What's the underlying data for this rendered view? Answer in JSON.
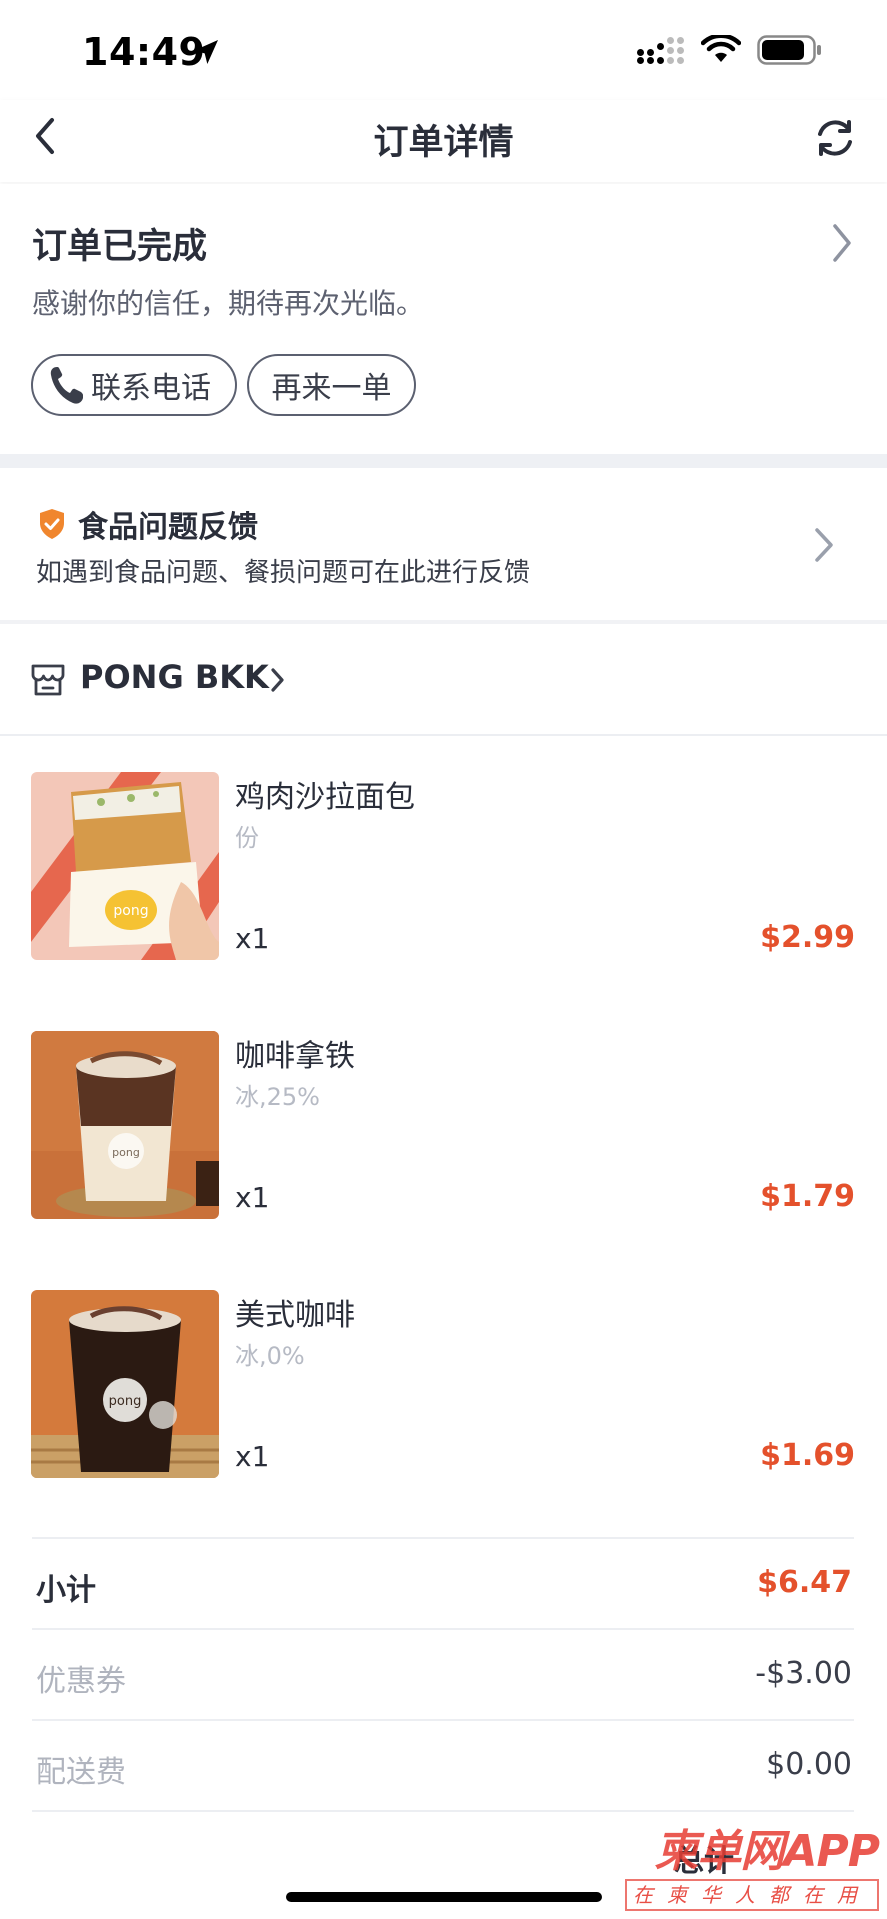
{
  "status_bar": {
    "time": "14:49"
  },
  "nav": {
    "title": "订单详情"
  },
  "order_status": {
    "title": "订单已完成",
    "subtitle": "感谢你的信任，期待再次光临。",
    "contact_label": "联系电话",
    "reorder_label": "再来一单"
  },
  "feedback": {
    "title": "食品问题反馈",
    "subtitle": "如遇到食品问题、餐损问题可在此进行反馈"
  },
  "store": {
    "name": "PONG BKK"
  },
  "items": [
    {
      "name": "鸡肉沙拉面包",
      "spec": "份",
      "qty": "x1",
      "price": "$2.99"
    },
    {
      "name": "咖啡拿铁",
      "spec": "冰,25%",
      "qty": "x1",
      "price": "$1.79"
    },
    {
      "name": "美式咖啡",
      "spec": "冰,0%",
      "qty": "x1",
      "price": "$1.69"
    }
  ],
  "totals": {
    "subtotal_label": "小计",
    "subtotal_value": "$6.47",
    "coupon_label": "优惠券",
    "coupon_value": "-$3.00",
    "delivery_label": "配送费",
    "delivery_value": "$0.00",
    "total_label": "总计"
  },
  "watermark": {
    "main": "柬单网APP",
    "sub": "在柬华人都在用"
  },
  "colors": {
    "accent": "#e4512c",
    "text": "#2a2e3a",
    "muted": "#b0b4be"
  }
}
